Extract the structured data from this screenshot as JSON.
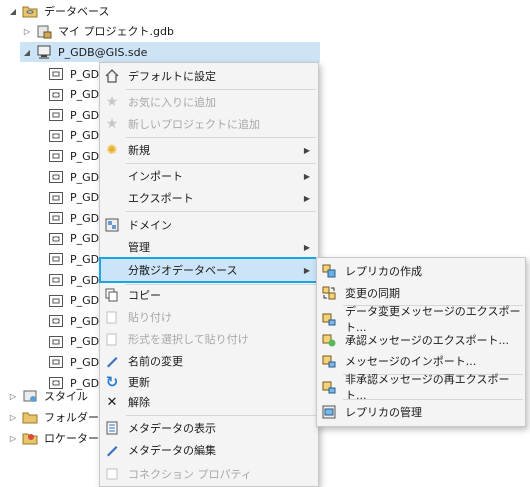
{
  "tree": {
    "items": [
      {
        "label": "データベース",
        "expander": "open",
        "icon": "database-folder-icon"
      },
      {
        "label": "マイ プロジェクト.gdb",
        "expander": "closed",
        "icon": "geodatabase-icon"
      },
      {
        "label": "P_GDB@GIS.sde",
        "expander": "open",
        "icon": "sde-connection-icon"
      }
    ],
    "children": [
      "P_GDE",
      "P_GDE",
      "P_GDE",
      "P_GDE",
      "P_GDE",
      "P_GDE",
      "P_GDE",
      "P_GDE",
      "P_GDE",
      "P_GDE",
      "P_GDE",
      "P_GDE",
      "P_GDE",
      "P_GDE",
      "P_GDE",
      "P_GDE"
    ],
    "bottom": [
      {
        "label": "スタイル",
        "icon": "style-icon"
      },
      {
        "label": "フォルダー",
        "icon": "folder-icon"
      },
      {
        "label": "ロケーター",
        "icon": "locator-icon"
      }
    ]
  },
  "menu": {
    "default": "デフォルトに設定",
    "fav_add": "お気に入りに追加",
    "new_proj_add": "新しいプロジェクトに追加",
    "new": "新規",
    "import": "インポート",
    "export": "エクスポート",
    "domain": "ドメイン",
    "manage": "管理",
    "distributed": "分散ジオデータベース",
    "copy": "コピー",
    "paste": "貼り付け",
    "paste_special": "形式を選択して貼り付け",
    "rename": "名前の変更",
    "refresh": "更新",
    "remove": "解除",
    "view_meta": "メタデータの表示",
    "edit_meta": "メタデータの編集",
    "conn_props": "コネクション プロパティ"
  },
  "submenu": {
    "create_replica": "レプリカの作成",
    "sync": "変更の同期",
    "export_change": "データ変更メッセージのエクスポート...",
    "export_ack": "承認メッセージのエクスポート...",
    "import_msg": "メッセージのインポート...",
    "reexport_unack": "非承認メッセージの再エクスポート...",
    "manage_replicas": "レプリカの管理"
  },
  "colors": {
    "accent": "#1aa6e2",
    "selection": "#cde4f7",
    "disabled": "#a8a8a8"
  }
}
